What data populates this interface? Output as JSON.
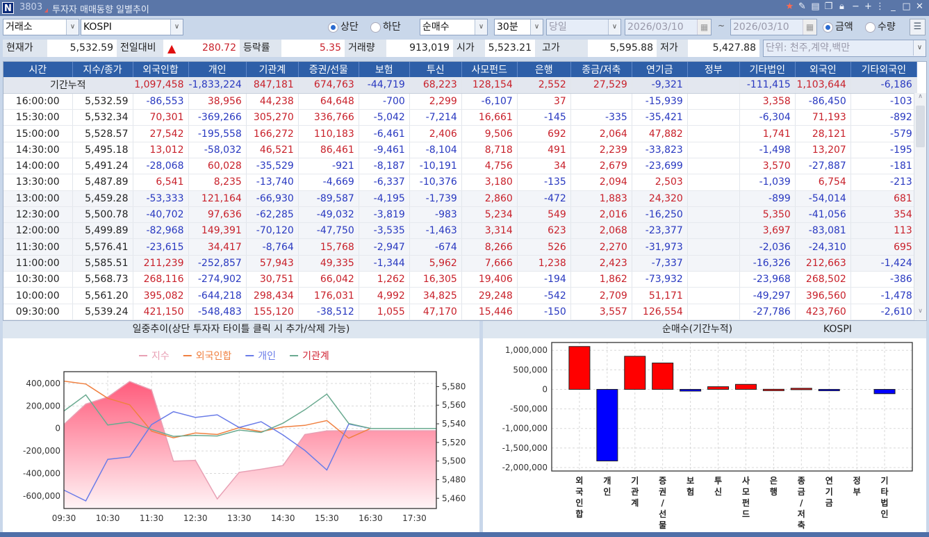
{
  "window": {
    "screen_no": "3803",
    "title": "투자자 매매동향 일별추이",
    "icons": [
      "star-icon",
      "pin-icon",
      "save-icon",
      "window-icon",
      "lock-icon",
      "minus-icon",
      "plus-icon",
      "more-icon",
      "minimize-icon",
      "maximize-icon",
      "close-icon"
    ]
  },
  "controls": {
    "market": "거래소",
    "index": "KOSPI",
    "position_options": [
      "상단",
      "하단"
    ],
    "position_selected": "상단",
    "trade_type": "순매수",
    "interval": "30분",
    "period": "당일",
    "date_from": "2026/03/10",
    "date_sep": "~",
    "date_to": "2026/03/10",
    "unit_options": [
      "금액",
      "수량"
    ],
    "unit_selected": "금액"
  },
  "quote": {
    "current_label": "현재가",
    "current": "5,532.59",
    "change_label": "전일대비",
    "change": "280.72",
    "change_dir": "up",
    "rate_label": "등락률",
    "rate": "5.35",
    "volume_label": "거래량",
    "volume": "913,019",
    "open_label": "시가",
    "open": "5,523.21",
    "high_label": "고가",
    "high": "5,595.88",
    "low_label": "저가",
    "low": "5,427.88",
    "unit_note": "단위: 천주,계약,백만"
  },
  "colors": {
    "positive": "#c8202a",
    "negative": "#2838c0",
    "header": "#2e5fa8",
    "index_fill": "#ff5c7c",
    "foreign": "#f08040",
    "personal": "#6a7ce8",
    "institution": "#6aaa90"
  },
  "table": {
    "columns": [
      "시간",
      "지수/종가",
      "외국인합",
      "개인",
      "기관계",
      "증권/선물",
      "보험",
      "투신",
      "사모펀드",
      "은행",
      "종금/저축",
      "연기금",
      "정부",
      "기타법인",
      "외국인",
      "기타외국인"
    ],
    "summary_label": "기간누적",
    "summary": [
      "1,097,458",
      "-1,833,224",
      "847,181",
      "674,763",
      "-44,719",
      "68,223",
      "128,154",
      "2,552",
      "27,529",
      "-9,321",
      "",
      "-111,415",
      "1,103,644",
      "-6,186"
    ],
    "rows": [
      [
        "16:00:00",
        "5,532.59",
        "-86,553",
        "38,956",
        "44,238",
        "64,648",
        "-700",
        "2,299",
        "-6,107",
        "37",
        "",
        "-15,939",
        "",
        "3,358",
        "-86,450",
        "-103"
      ],
      [
        "15:30:00",
        "5,532.34",
        "70,301",
        "-369,266",
        "305,270",
        "336,766",
        "-5,042",
        "-7,214",
        "16,661",
        "-145",
        "-335",
        "-35,421",
        "",
        "-6,304",
        "71,193",
        "-892"
      ],
      [
        "15:00:00",
        "5,528.57",
        "27,542",
        "-195,558",
        "166,272",
        "110,183",
        "-6,461",
        "2,406",
        "9,506",
        "692",
        "2,064",
        "47,882",
        "",
        "1,741",
        "28,121",
        "-579"
      ],
      [
        "14:30:00",
        "5,495.18",
        "13,012",
        "-58,032",
        "46,521",
        "86,461",
        "-9,461",
        "-8,104",
        "8,718",
        "491",
        "2,239",
        "-33,823",
        "",
        "-1,498",
        "13,207",
        "-195"
      ],
      [
        "14:00:00",
        "5,491.24",
        "-28,068",
        "60,028",
        "-35,529",
        "-921",
        "-8,187",
        "-10,191",
        "4,756",
        "34",
        "2,679",
        "-23,699",
        "",
        "3,570",
        "-27,887",
        "-181"
      ],
      [
        "13:30:00",
        "5,487.89",
        "6,541",
        "8,235",
        "-13,740",
        "-4,669",
        "-6,337",
        "-10,376",
        "3,180",
        "-135",
        "2,094",
        "2,503",
        "",
        "-1,039",
        "6,754",
        "-213"
      ],
      [
        "13:00:00",
        "5,459.28",
        "-53,333",
        "121,164",
        "-66,930",
        "-89,587",
        "-4,195",
        "-1,739",
        "2,860",
        "-472",
        "1,883",
        "24,320",
        "",
        "-899",
        "-54,014",
        "681"
      ],
      [
        "12:30:00",
        "5,500.78",
        "-40,702",
        "97,636",
        "-62,285",
        "-49,032",
        "-3,819",
        "-983",
        "5,234",
        "549",
        "2,016",
        "-16,250",
        "",
        "5,350",
        "-41,056",
        "354"
      ],
      [
        "12:00:00",
        "5,499.89",
        "-82,968",
        "149,391",
        "-70,120",
        "-47,750",
        "-3,535",
        "-1,463",
        "3,314",
        "623",
        "2,068",
        "-23,377",
        "",
        "3,697",
        "-83,081",
        "113"
      ],
      [
        "11:30:00",
        "5,576.41",
        "-23,615",
        "34,417",
        "-8,764",
        "15,768",
        "-2,947",
        "-674",
        "8,266",
        "526",
        "2,270",
        "-31,973",
        "",
        "-2,036",
        "-24,310",
        "695"
      ],
      [
        "11:00:00",
        "5,585.51",
        "211,239",
        "-252,857",
        "57,943",
        "49,335",
        "-1,344",
        "5,962",
        "7,666",
        "1,238",
        "2,423",
        "-7,337",
        "",
        "-16,326",
        "212,663",
        "-1,424"
      ],
      [
        "10:30:00",
        "5,568.73",
        "268,116",
        "-274,902",
        "30,751",
        "66,042",
        "1,262",
        "16,305",
        "19,406",
        "-194",
        "1,862",
        "-73,932",
        "",
        "-23,968",
        "268,502",
        "-386"
      ],
      [
        "10:00:00",
        "5,561.20",
        "395,082",
        "-644,218",
        "298,434",
        "176,031",
        "4,992",
        "34,825",
        "29,248",
        "-542",
        "2,709",
        "51,171",
        "",
        "-49,297",
        "396,560",
        "-1,478"
      ],
      [
        "09:30:00",
        "5,539.24",
        "421,150",
        "-548,483",
        "155,120",
        "-38,512",
        "1,055",
        "47,170",
        "15,446",
        "-150",
        "3,557",
        "126,554",
        "",
        "-27,786",
        "423,760",
        "-2,610"
      ]
    ]
  },
  "chart_data": [
    {
      "type": "line",
      "title": "일중추이(상단 투자자 타이틀 클릭 시 추가/삭제 가능)",
      "x": [
        "09:30",
        "10:00",
        "10:30",
        "11:00",
        "11:30",
        "12:00",
        "12:30",
        "13:00",
        "13:30",
        "14:00",
        "14:30",
        "15:00",
        "15:30",
        "16:00",
        "16:30",
        "17:00",
        "17:30",
        "18:00"
      ],
      "xticks": [
        "09:30",
        "10:30",
        "11:30",
        "12:30",
        "13:30",
        "14:30",
        "15:30",
        "16:30",
        "17:30"
      ],
      "legend_position": "top-center",
      "grid": true,
      "left_axis": {
        "ylim": [
          -712000,
          505000
        ],
        "ticks": [
          400000,
          200000,
          0,
          -200000,
          -400000,
          -600000
        ],
        "tick_labels": [
          "400,000",
          "200,000",
          "0",
          "-200,000",
          "-400,000",
          "-600,000"
        ]
      },
      "right_axis": {
        "ylim": [
          5449,
          5596
        ],
        "ticks": [
          5580,
          5560,
          5540,
          5520,
          5500,
          5480,
          5460
        ],
        "tick_labels": [
          "5,580",
          "5,560",
          "5,540",
          "5,520",
          "5,500",
          "5,480",
          "5,460"
        ]
      },
      "series": [
        {
          "name": "지수",
          "axis": "right",
          "style": "area",
          "color": "#e8a0b4",
          "values": [
            5539.24,
            5561.2,
            5568.73,
            5585.51,
            5576.41,
            5499.89,
            5500.78,
            5459.28,
            5487.89,
            5491.24,
            5495.18,
            5528.57,
            5532.34,
            5532.59,
            5532.59,
            5532.59,
            5532.59,
            5532.59
          ]
        },
        {
          "name": "외국인합",
          "axis": "left",
          "color": "#f08040",
          "values": [
            421150,
            395082,
            268116,
            211239,
            -23615,
            -82968,
            -40702,
            -53333,
            6541,
            -28068,
            13012,
            27542,
            70301,
            -86553,
            0,
            null,
            null,
            null
          ]
        },
        {
          "name": "개인",
          "axis": "left",
          "color": "#6a7ce8",
          "values": [
            -548483,
            -644218,
            -274902,
            -252857,
            34417,
            149391,
            97636,
            121164,
            8235,
            60028,
            -58032,
            -195558,
            -369266,
            38956,
            0,
            0,
            0,
            0
          ]
        },
        {
          "name": "기관계",
          "axis": "left",
          "color": "#6aaa90",
          "label_color": "#d02030",
          "values": [
            155120,
            298434,
            30751,
            57943,
            -8764,
            -70120,
            -62285,
            -66930,
            -13740,
            -35529,
            46521,
            166272,
            305270,
            44238,
            0,
            0,
            0,
            0
          ]
        }
      ]
    },
    {
      "type": "bar",
      "title": "순매수(기간누적)",
      "subtitle": "KOSPI",
      "grid": true,
      "categories": [
        "외국인합",
        "개인",
        "기관계",
        "증권/선물",
        "보험",
        "투신",
        "사모펀드",
        "은행",
        "종금/저축",
        "연기금",
        "정부",
        "기타법인"
      ],
      "values": [
        1097458,
        -1833224,
        847181,
        674763,
        -44719,
        68223,
        128154,
        2552,
        27529,
        -9321,
        0,
        -111415
      ],
      "ylim": [
        -2090000,
        1200000
      ],
      "ticks": [
        1000000,
        500000,
        0,
        -500000,
        -1000000,
        -1500000,
        -2000000
      ],
      "tick_labels": [
        "1,000,000",
        "500,000",
        "0",
        "-500,000",
        "-1,000,000",
        "-1,500,000",
        "-2,000,000"
      ],
      "positive_color": "#ff0000",
      "negative_color": "#0000ff"
    }
  ]
}
